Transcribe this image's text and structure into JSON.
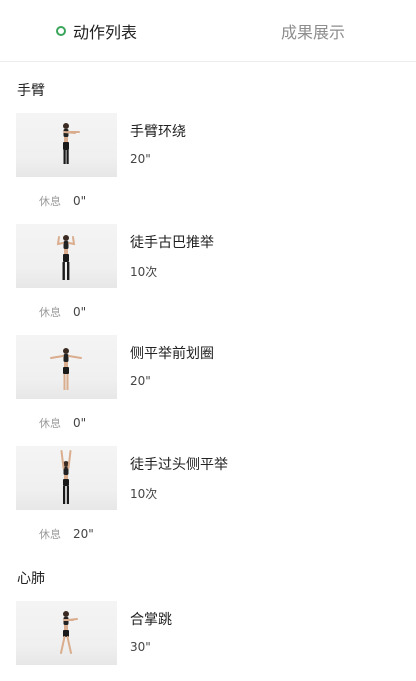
{
  "tabs": [
    {
      "label": "动作列表",
      "active": true
    },
    {
      "label": "成果展示",
      "active": false
    }
  ],
  "accent_color": "#3aa55a",
  "sections": [
    {
      "title": "手臂",
      "exercises": [
        {
          "name": "手臂环绕",
          "amount": "20\"",
          "rest_label": "休息",
          "rest_value": "0\""
        },
        {
          "name": "徒手古巴推举",
          "amount": "10次",
          "rest_label": "休息",
          "rest_value": "0\""
        },
        {
          "name": "侧平举前划圈",
          "amount": "20\"",
          "rest_label": "休息",
          "rest_value": "0\""
        },
        {
          "name": "徒手过头侧平举",
          "amount": "10次",
          "rest_label": "休息",
          "rest_value": "20\""
        }
      ]
    },
    {
      "title": "心肺",
      "exercises": [
        {
          "name": "合掌跳",
          "amount": "30\""
        }
      ]
    }
  ]
}
